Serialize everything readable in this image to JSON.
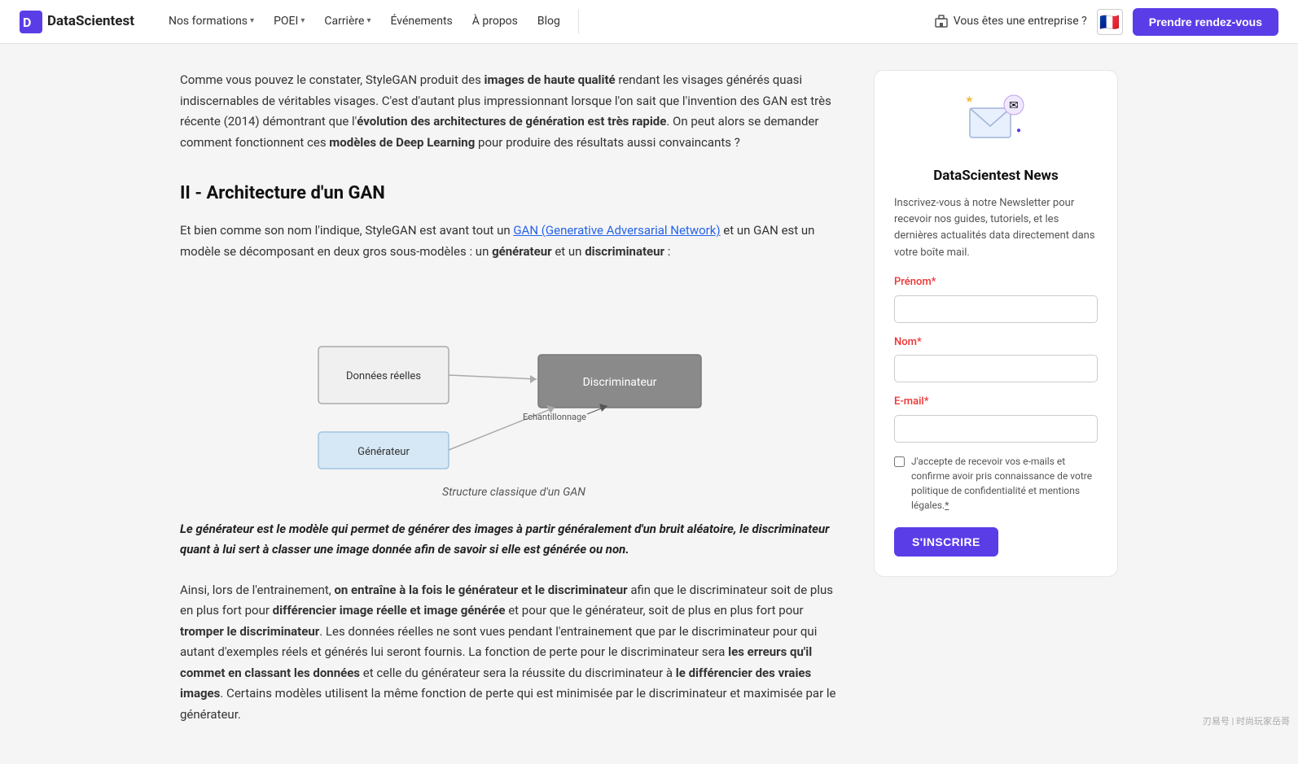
{
  "nav": {
    "logo_text": "DataScientest",
    "links": [
      {
        "label": "Nos formations",
        "has_dropdown": true
      },
      {
        "label": "POEI",
        "has_dropdown": true
      },
      {
        "label": "Carrière",
        "has_dropdown": true
      },
      {
        "label": "Événements",
        "has_dropdown": false
      },
      {
        "label": "À propos",
        "has_dropdown": false
      },
      {
        "label": "Blog",
        "has_dropdown": false
      }
    ],
    "enterprise_label": "Vous êtes une entreprise ?",
    "cta_label": "Prendre rendez-vous"
  },
  "main": {
    "intro_para1": "Comme vous pouvez le constater, StyleGAN produit des ",
    "intro_bold1": "images de haute qualité",
    "intro_para1_rest": " rendant les visages générés quasi indiscernables de véritables visages. C'est d'autant plus impressionnant lorsque l'on sait que l'invention des GAN est très récente (2014) démontrant que l'",
    "intro_bold2": "évolution des architectures de génération est très rapide",
    "intro_para1_end": ". On peut alors se demander comment fonctionnent ces ",
    "intro_bold3": "modèles de Deep Learning",
    "intro_para1_final": " pour produire des résultats aussi convaincants ?",
    "section2_title": "II - Architecture d'un GAN",
    "section2_para1_start": "Et bien comme son nom l'indique, StyleGAN est avant tout un ",
    "section2_link_text": "GAN (Generative Adversarial Network)",
    "section2_para1_mid": " et un GAN est un modèle se décomposant en deux gros sous-modèles : un ",
    "section2_bold1": "générateur",
    "section2_para1_and": " et un ",
    "section2_bold2": "discriminateur",
    "section2_para1_end": " :",
    "diagram_caption": "Structure classique d'un GAN",
    "diagram_labels": {
      "donnees_reelles": "Données réelles",
      "generateur": "Générateur",
      "echantillonnage": "Echantillonnage",
      "discriminateur": "Discriminateur"
    },
    "callout": "Le générateur est le modèle qui permet de générer des images à partir généralement d'un bruit aléatoire, le discriminateur quant à lui sert à classer une image donnée afin de savoir si elle est générée ou non.",
    "para3_start": "Ainsi, lors de l'entrainement, ",
    "para3_bold1": "on entraîne à la fois le générateur et le discriminateur",
    "para3_mid": " afin que le discriminateur soit de plus en plus fort pour ",
    "para3_bold2": "différencier image réelle et image générée",
    "para3_mid2": " et pour que le générateur, soit de plus en plus fort pour ",
    "para3_bold3": "tromper le discriminateur",
    "para3_rest": ". Les données réelles ne sont vues pendant l'entrainement que par le discriminateur pour qui autant d'exemples réels et générés lui seront fournis. La fonction de perte pour le discriminateur sera ",
    "para3_bold4": "les erreurs qu'il commet en classant les données",
    "para3_mid3": " et celle du générateur sera la réussite du discriminateur à ",
    "para3_bold5": "le différencier des vraies images",
    "para3_end": ". Certains modèles utilisent la même fonction de perte qui est minimisée par le discriminateur et maximisée par le générateur."
  },
  "sidebar": {
    "newsletter_title": "DataScientest News",
    "newsletter_desc": "Inscrivez-vous à notre Newsletter pour recevoir nos guides, tutoriels, et les dernières actualités data directement dans votre boîte mail.",
    "prenom_label": "Prénom",
    "nom_label": "Nom",
    "email_label": "E-mail",
    "required_mark": "*",
    "checkbox_text": "J'accepte de recevoir vos e-mails et confirme avoir pris connaissance de votre politique de confidentialité et mentions légales.",
    "subscribe_label": "S'INSCRIRE"
  },
  "watermark": {
    "text": "刃易号 | 时尚玩家岳哥"
  },
  "colors": {
    "accent": "#5b3de8",
    "link": "#2563eb",
    "diagram_box_gray": "#8a8a8a",
    "diagram_box_blue": "#d6e8f5",
    "diagram_box_border_blue": "#a0c4e0",
    "diagram_box_border_gray": "#a0a0a0"
  }
}
